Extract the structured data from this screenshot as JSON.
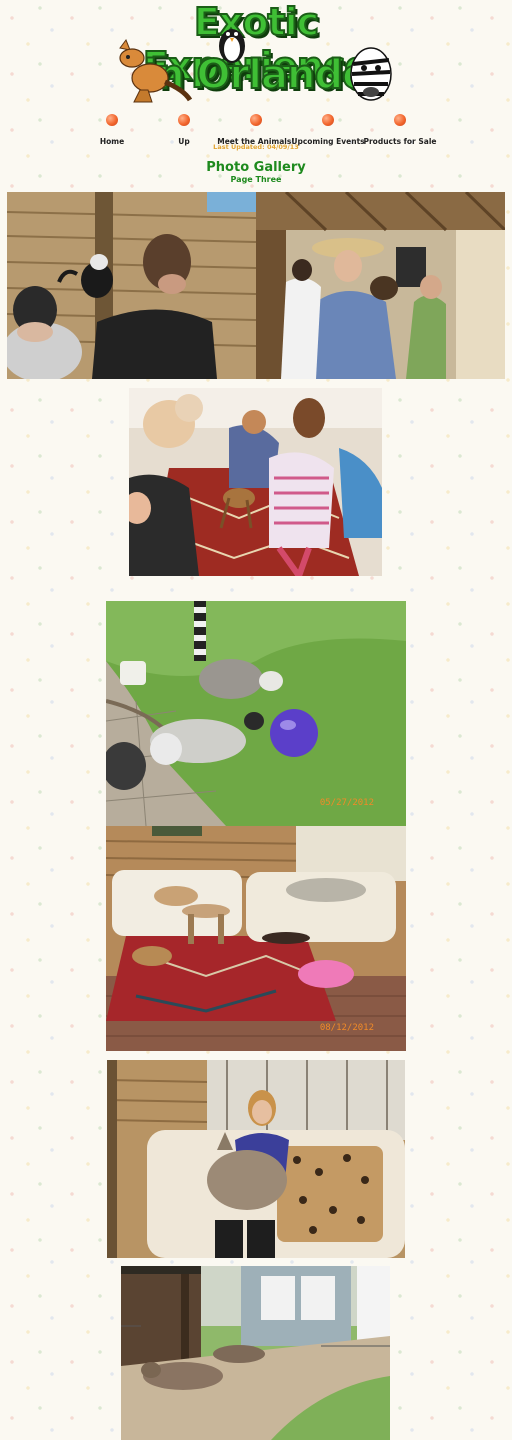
{
  "header": {
    "logo_line1": "Exotic Experience",
    "logo_line2": "in Orlando"
  },
  "nav": {
    "items": [
      {
        "label": "Home"
      },
      {
        "label": "Up"
      },
      {
        "label": "Meet the Animals!"
      },
      {
        "label": "Upcoming Events"
      },
      {
        "label": "Products for Sale"
      }
    ],
    "dot_color": "#f2662d"
  },
  "last_updated": "Last Updated: 04/09/13",
  "gallery": {
    "title": "Photo Gallery",
    "subtitle": "Page Three"
  },
  "photos": {
    "lemur_stamp": "05/27/2012",
    "living_room_stamp": "08/12/2012"
  },
  "colors": {
    "title_green": "#1e8a1e",
    "updated_gold": "#e2a634",
    "logo_green": "#3fbf35"
  }
}
